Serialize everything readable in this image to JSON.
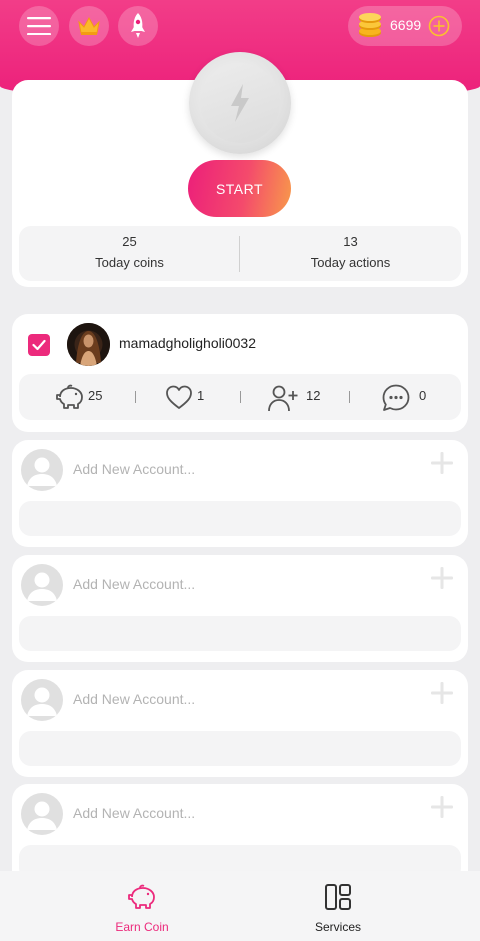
{
  "header": {
    "coin_balance": "6699",
    "accent_color": "#ec1f7a"
  },
  "start": {
    "button_label": "START"
  },
  "stats": [
    {
      "value": "25",
      "label": "Today coins"
    },
    {
      "value": "13",
      "label": "Today actions"
    }
  ],
  "account": {
    "username": "mamadgholigholi0032",
    "checked": true,
    "metrics": {
      "coins": "25",
      "likes": "1",
      "follows": "12",
      "comments": "0"
    }
  },
  "empty_accounts": [
    {
      "placeholder": "Add New Account..."
    },
    {
      "placeholder": "Add New Account..."
    },
    {
      "placeholder": "Add New Account..."
    },
    {
      "placeholder": "Add New Account..."
    }
  ],
  "nav": {
    "earn_label": "Earn Coin",
    "services_label": "Services",
    "active": "earn",
    "active_color": "#ec2a7c"
  }
}
